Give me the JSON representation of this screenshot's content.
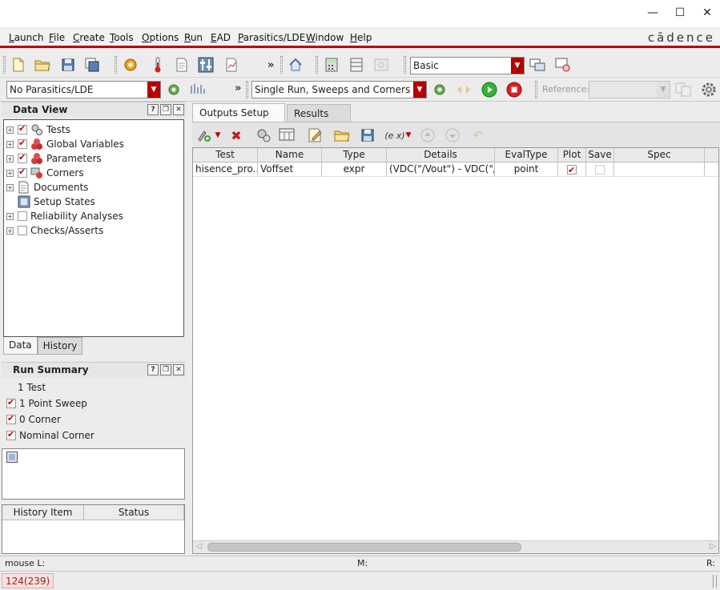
{
  "window": {
    "minimize_glyph": "—",
    "maximize_glyph": "☐",
    "close_glyph": "✕"
  },
  "menu": {
    "items": [
      {
        "label": "Launch",
        "u": "L",
        "rest": "aunch"
      },
      {
        "label": "File",
        "u": "F",
        "rest": "ile"
      },
      {
        "label": "Create",
        "u": "C",
        "rest": "reate"
      },
      {
        "label": "Tools",
        "u": "T",
        "rest": "ools"
      },
      {
        "label": "Options",
        "u": "O",
        "rest": "ptions"
      },
      {
        "label": "Run",
        "u": "R",
        "rest": "un"
      },
      {
        "label": "EAD",
        "u": "E",
        "rest": "AD"
      },
      {
        "label": "Parasitics/LDE",
        "u": "P",
        "rest": "arasitics/LDE"
      },
      {
        "label": "Window",
        "u": "W",
        "rest": "indow"
      },
      {
        "label": "Help",
        "u": "H",
        "rest": "elp"
      }
    ],
    "brand": "cādence"
  },
  "toolbar": {
    "more": "»",
    "mode_select": "Basic",
    "parasitics_select": "No Parasitics/LDE",
    "run_mode_select": "Single Run, Sweeps and Corners",
    "reference_label": "Reference:",
    "reference_value": ""
  },
  "data_view": {
    "title": "Data View",
    "items": [
      {
        "label": "Tests",
        "checked": true,
        "icon": "tests-icon"
      },
      {
        "label": "Global Variables",
        "checked": true,
        "icon": "global-variables-icon"
      },
      {
        "label": "Parameters",
        "checked": true,
        "icon": "parameters-icon"
      },
      {
        "label": "Corners",
        "checked": true,
        "icon": "corners-icon"
      },
      {
        "label": "Documents",
        "icon": "documents-icon"
      },
      {
        "label": "Setup States",
        "icon": "setup-states-icon"
      },
      {
        "label": "Reliability Analyses",
        "checked": false
      },
      {
        "label": "Checks/Asserts",
        "checked": false
      }
    ],
    "tabs": [
      "Data",
      "History"
    ]
  },
  "run_summary": {
    "title": "Run Summary",
    "rows": [
      {
        "label": "1 Test"
      },
      {
        "label": "1 Point Sweep",
        "checked": true
      },
      {
        "label": "0 Corner",
        "checked": true
      },
      {
        "label": "Nominal Corner",
        "checked": true
      }
    ]
  },
  "history_table": {
    "columns": [
      "History Item",
      "Status"
    ]
  },
  "main_tabs": [
    "Outputs Setup",
    "Results"
  ],
  "outputs": {
    "columns": [
      "Test",
      "Name",
      "Type",
      "Details",
      "EvalType",
      "Plot",
      "Save",
      "Spec"
    ],
    "rows": [
      {
        "test": "hisence_pro...",
        "name": "Voffset",
        "type": "expr",
        "details": "(VDC(\"/Vout\") - VDC(\"/V...",
        "evaltype": "point",
        "plot": true,
        "save": false,
        "spec": ""
      }
    ]
  },
  "status": {
    "mouse_l": "mouse L:",
    "mouse_m": "M:",
    "mouse_r": "R:",
    "cmd": "124(239)"
  }
}
